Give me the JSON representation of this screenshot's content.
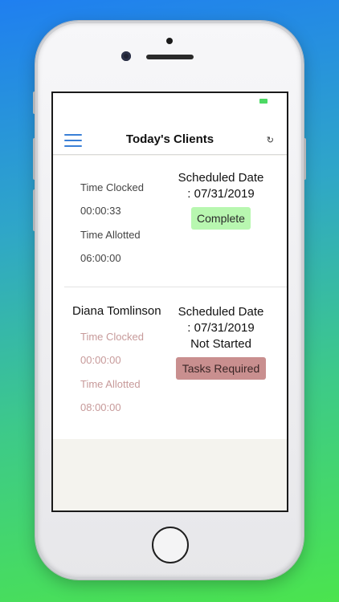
{
  "navbar": {
    "title": "Today's Clients",
    "menu_icon": "hamburger-menu-icon",
    "refresh_icon": "refresh-icon",
    "refresh_glyph": "↻"
  },
  "clients": [
    {
      "name": "",
      "time_clocked_label": "Time Clocked",
      "time_clocked": "00:00:33",
      "time_allotted_label": "Time Allotted",
      "time_allotted": "06:00:00",
      "scheduled_line1": "Scheduled Date",
      "scheduled_line2": ": 07/31/2019",
      "status_text": "",
      "badge": "Complete",
      "badge_color": "#b8f7b0"
    },
    {
      "name": "Diana Tomlinson",
      "time_clocked_label": "Time Clocked",
      "time_clocked": "00:00:00",
      "time_allotted_label": "Time Allotted",
      "time_allotted": "08:00:00",
      "scheduled_line1": "Scheduled Date",
      "scheduled_line2": ": 07/31/2019",
      "status_text": "Not Started",
      "badge": "Tasks Required",
      "badge_color": "#c98f8f"
    }
  ],
  "colors": {
    "accent": "#3a7fd6",
    "battery": "#4cd964",
    "muted_label": "#c79a9a"
  }
}
